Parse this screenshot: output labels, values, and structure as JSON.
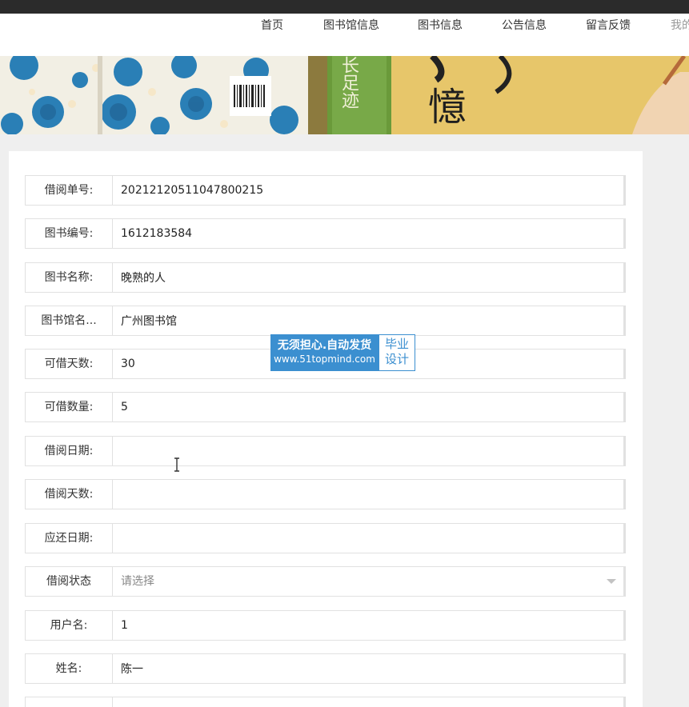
{
  "nav": {
    "items": [
      "首页",
      "图书馆信息",
      "图书信息",
      "公告信息",
      "留言反馈",
      "我的"
    ]
  },
  "form": {
    "fields": [
      {
        "label": "借阅单号:",
        "value": "20212120511047800215"
      },
      {
        "label": "图书编号:",
        "value": "1612183584"
      },
      {
        "label": "图书名称:",
        "value": "晚熟的人"
      },
      {
        "label": "图书馆名...",
        "value": "广州图书馆"
      },
      {
        "label": "可借天数:",
        "value": "30"
      },
      {
        "label": "可借数量:",
        "value": "5"
      },
      {
        "label": "借阅日期:",
        "value": ""
      },
      {
        "label": "借阅天数:",
        "value": ""
      },
      {
        "label": "应还日期:",
        "value": ""
      },
      {
        "label": "借阅状态",
        "value": "",
        "placeholder": "请选择"
      },
      {
        "label": "用户名:",
        "value": "1"
      },
      {
        "label": "姓名:",
        "value": "陈一"
      },
      {
        "label": "",
        "value": ""
      }
    ]
  },
  "watermark": {
    "line1": "无须担心.自动发货",
    "line2": "www.51topmind.com",
    "side": "毕业设计"
  },
  "banner": {
    "book_spine_text": "长足迹",
    "title_char": "忆",
    "title_char2": "憶"
  },
  "colors": {
    "topbar": "#2b2b2b",
    "accent_blue": "#3b8fd0",
    "banner_gold": "#e7c66a",
    "spine_green": "#6a9a3a"
  }
}
